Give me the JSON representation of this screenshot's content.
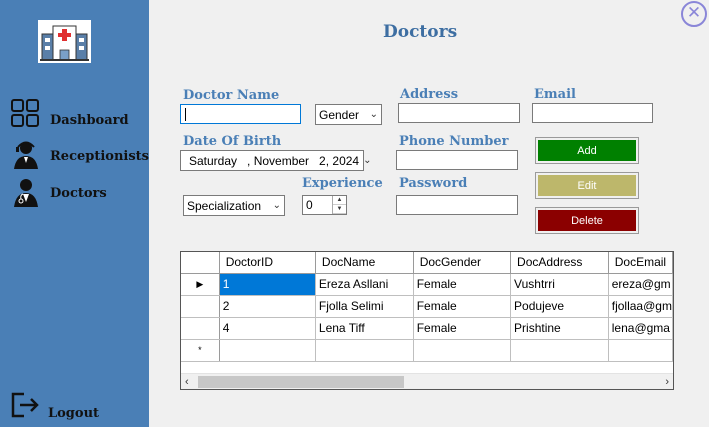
{
  "sidebar": {
    "items": [
      {
        "label": "Dashboard",
        "icon": "dashboard-grid-icon"
      },
      {
        "label": "Receptionists",
        "icon": "receptionist-icon"
      },
      {
        "label": "Doctors",
        "icon": "doctor-icon"
      }
    ],
    "logout": {
      "label": "Logout",
      "icon": "logout-icon"
    },
    "logo_icon": "hospital-icon"
  },
  "header": {
    "title": "Doctors",
    "close_glyph": "✕"
  },
  "form": {
    "doctor_name_label": "Doctor Name",
    "doctor_name_value": "",
    "gender_value": "Gender",
    "address_label": "Address",
    "address_value": "",
    "email_label": "Email",
    "email_value": "",
    "dob_label": "Date Of Birth",
    "dob_value": "Saturday   , November   2, 2024",
    "phone_label": "Phone Number",
    "phone_value": "",
    "experience_label": "Experience",
    "experience_value": "0",
    "specialization_value": "Specialization",
    "password_label": "Password",
    "password_value": ""
  },
  "buttons": {
    "add": "Add",
    "edit": "Edit",
    "delete": "Delete"
  },
  "colors": {
    "sidebar": "#4a7fb6",
    "accent_text": "#4a7fb6",
    "add": "#008000",
    "edit": "#bdb76b",
    "delete": "#8b0000",
    "selection": "#0078d7"
  },
  "grid": {
    "columns": [
      "DoctorID",
      "DocName",
      "DocGender",
      "DocAddress",
      "DocEmail"
    ],
    "rows": [
      [
        "1",
        "Ereza Asllani",
        "Female",
        "Vushtrri",
        "ereza@gm"
      ],
      [
        "2",
        "Fjolla Selimi",
        "Female",
        "Podujeve",
        "fjollaa@gm"
      ],
      [
        "4",
        "Lena Tiff",
        "Female",
        "Prishtine",
        "lena@gma"
      ]
    ],
    "current_row_marker": "▶",
    "new_row_marker": "*"
  }
}
